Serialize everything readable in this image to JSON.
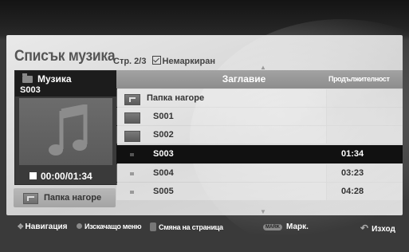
{
  "title": "Списък музика",
  "page_info": {
    "page_label": "Стр.",
    "page": "2/3",
    "filter_label": "Немаркиран"
  },
  "preview": {
    "category": "Музика",
    "file": "S003",
    "time": "00:00/01:34"
  },
  "folder_up_button": {
    "label": "Папка нагоре"
  },
  "table": {
    "columns": [
      "Заглавие",
      "Продължителност"
    ],
    "rows": [
      {
        "name": "Папка нагоре",
        "duration": "",
        "type": "up",
        "selected": false
      },
      {
        "name": "S001",
        "duration": "",
        "type": "folder",
        "selected": false
      },
      {
        "name": "S002",
        "duration": "",
        "type": "folder",
        "selected": false
      },
      {
        "name": "S003",
        "duration": "01:34",
        "type": "file",
        "selected": true
      },
      {
        "name": "S004",
        "duration": "03:23",
        "type": "file",
        "selected": false
      },
      {
        "name": "S005",
        "duration": "04:28",
        "type": "file",
        "selected": false
      }
    ]
  },
  "help_bar": {
    "navigation": "Навигация",
    "popup_menu": "Изскачащо меню",
    "page_change": "Смяна на страница",
    "mark_key": "MARK",
    "mark": "Марк.",
    "exit": "Изход"
  }
}
